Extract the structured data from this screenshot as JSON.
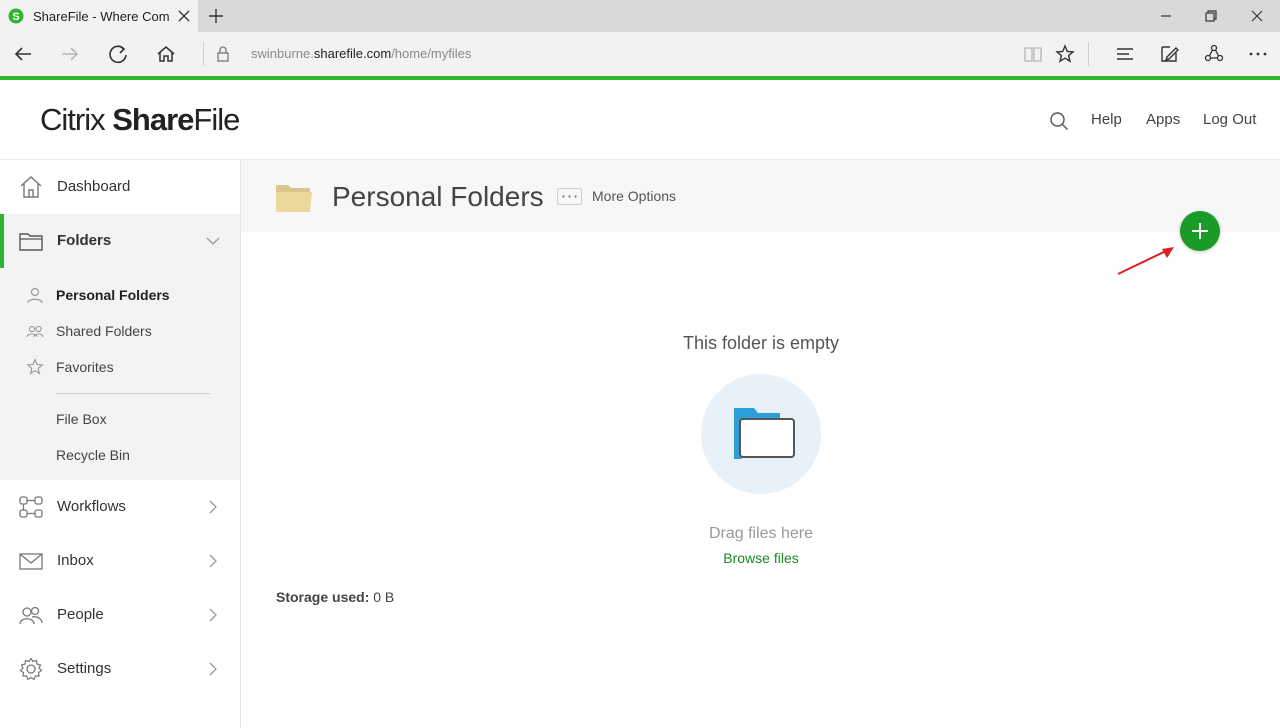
{
  "browser": {
    "tab_title": "ShareFile - Where Comp",
    "url_prefix": "swinburne.",
    "url_host": "sharefile.com",
    "url_path": "/home/myfiles"
  },
  "app": {
    "logo_light": "Citrix ",
    "logo_bold": "Share",
    "logo_tail": "File",
    "header_links": {
      "help": "Help",
      "apps": "Apps",
      "logout": "Log Out"
    }
  },
  "sidebar": {
    "dashboard": "Dashboard",
    "folders": "Folders",
    "sub_items": {
      "personal": "Personal Folders",
      "shared": "Shared Folders",
      "favorites": "Favorites",
      "filebox": "File Box",
      "recycle": "Recycle Bin"
    },
    "workflows": "Workflows",
    "inbox": "Inbox",
    "people": "People",
    "settings": "Settings"
  },
  "main": {
    "page_title": "Personal Folders",
    "more_options": "More Options",
    "empty_title": "This folder is empty",
    "drag_text": "Drag files here",
    "browse_link": "Browse files",
    "storage_label": "Storage used:",
    "storage_value": "0 B"
  },
  "colors": {
    "accent_green": "#2db52d",
    "fab_green": "#1a9a26",
    "link_green": "#1a8a22",
    "annotation_red": "#e02020"
  }
}
